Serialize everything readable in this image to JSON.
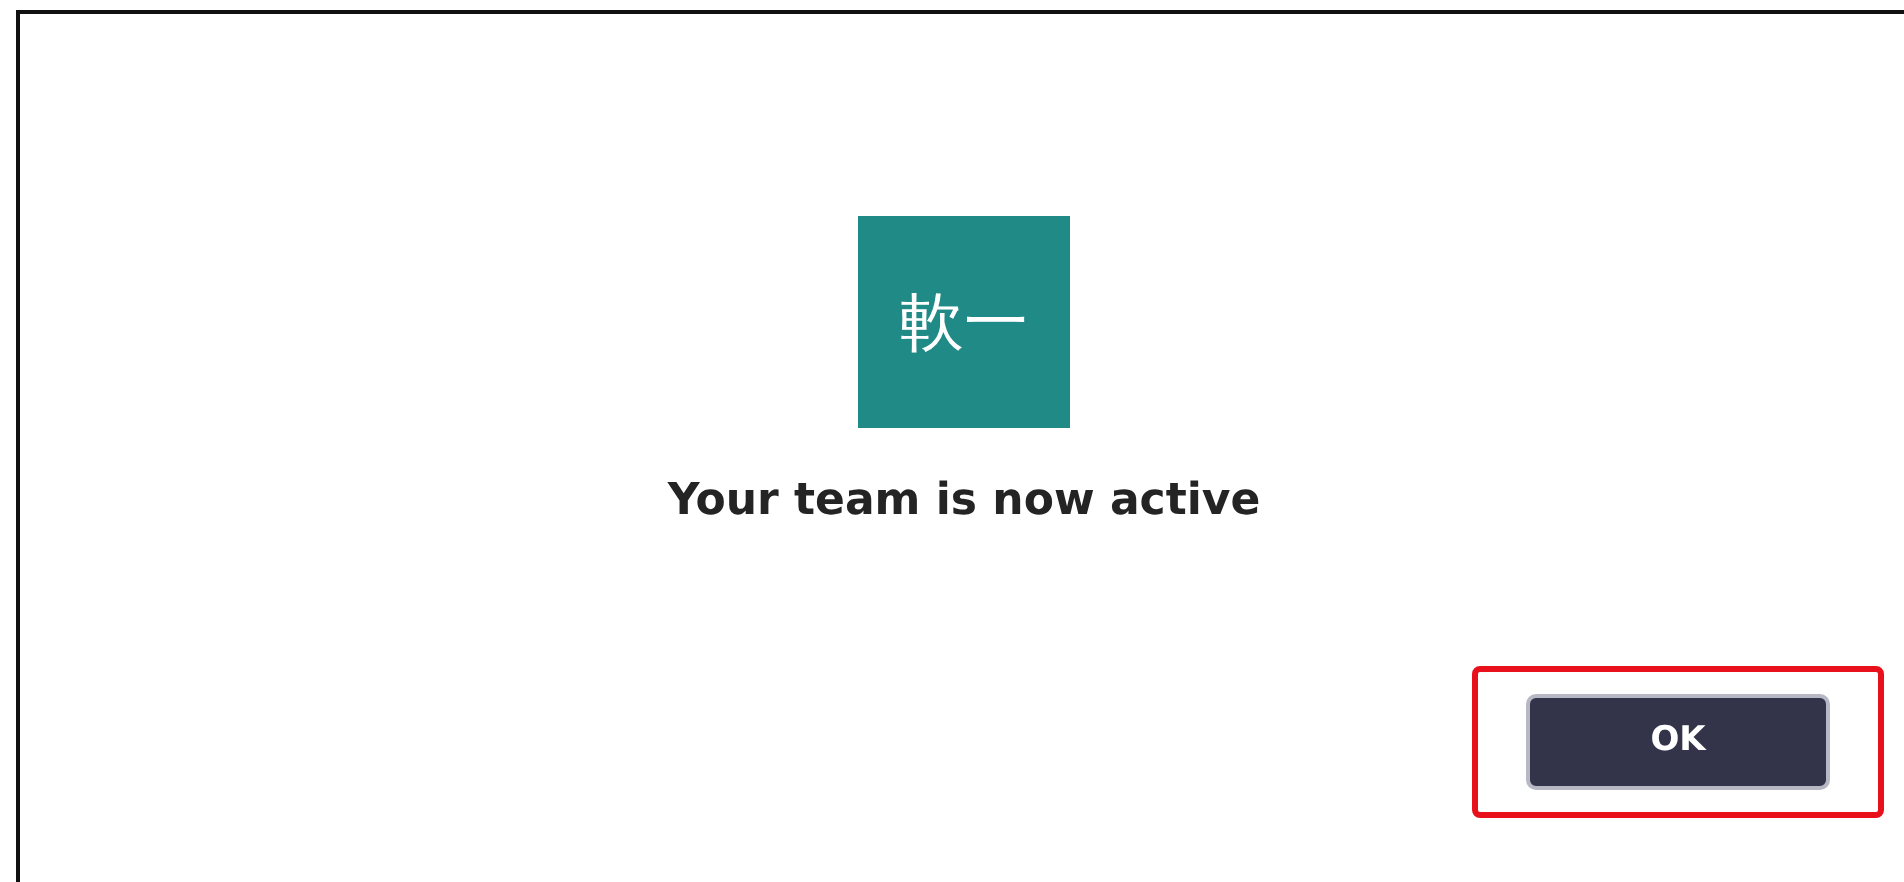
{
  "dialog": {
    "avatar": "軟一",
    "title": "Your team is now active",
    "buttons": [
      {
        "label": "OK",
        "highlighted": true
      }
    ]
  }
}
